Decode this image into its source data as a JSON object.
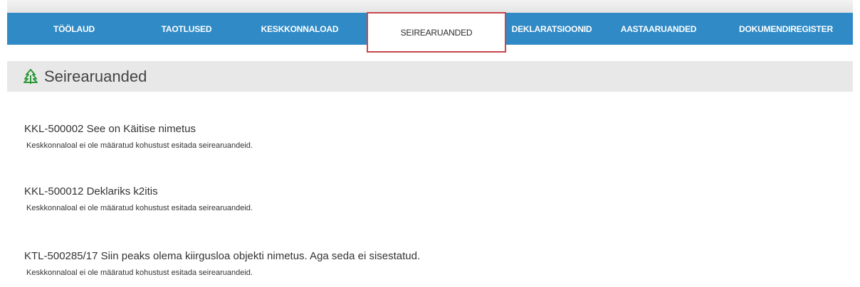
{
  "nav": {
    "items": [
      {
        "label": "TÖÖLAUD"
      },
      {
        "label": "TAOTLUSED"
      },
      {
        "label": "KESKKONNALOAD"
      },
      {
        "label": "SEIREARUANDED"
      },
      {
        "label": "DEKLARATSIOONID"
      },
      {
        "label": "AASTAARUANDED"
      },
      {
        "label": "DOKUMENDIREGISTER"
      }
    ],
    "active": "SEIREARUANDED",
    "bar_color": "#2f8ac6",
    "highlight_color": "#c8464a"
  },
  "page": {
    "title": "Seirearuanded",
    "icon": "tree-icon",
    "icon_color": "#2e9a3a"
  },
  "entries": [
    {
      "title": "KKL-500002 See on Käitise nimetus",
      "note": "Keskkonnaloal ei ole määratud kohustust esitada seirearuandeid."
    },
    {
      "title": "KKL-500012 Deklariks k2itis",
      "note": "Keskkonnaloal ei ole määratud kohustust esitada seirearuandeid."
    },
    {
      "title": "KTL-500285/17 Siin peaks olema kiirgusloa objekti nimetus. Aga seda ei sisestatud.",
      "note": "Keskkonnaloal ei ole määratud kohustust esitada seirearuandeid."
    }
  ]
}
